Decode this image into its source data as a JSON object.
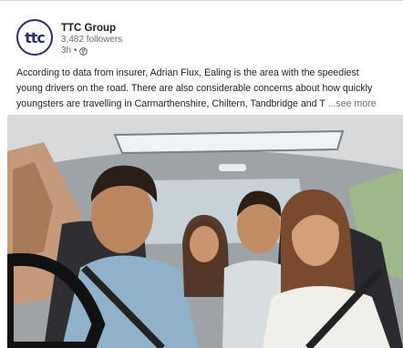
{
  "post": {
    "avatar_text": "ttc",
    "company": "TTC Group",
    "followers": "3,482 followers",
    "time": "3h •",
    "text_line1": "According to data from insurer, Adrian Flux, Ealing is the area with the speediest",
    "text_line2": "young drivers on the road. There are also considerable concerns about how quickly",
    "text_line3": "youngsters are travelling in Carmarthenshire, Chiltern, Tandbridge and T",
    "see_more": "...see more",
    "image_icon": "photo-of-young-people-in-car"
  },
  "colors": {
    "brand": "#2b2d6e",
    "text": "#1a1a1a",
    "muted": "#6b6b6b"
  }
}
